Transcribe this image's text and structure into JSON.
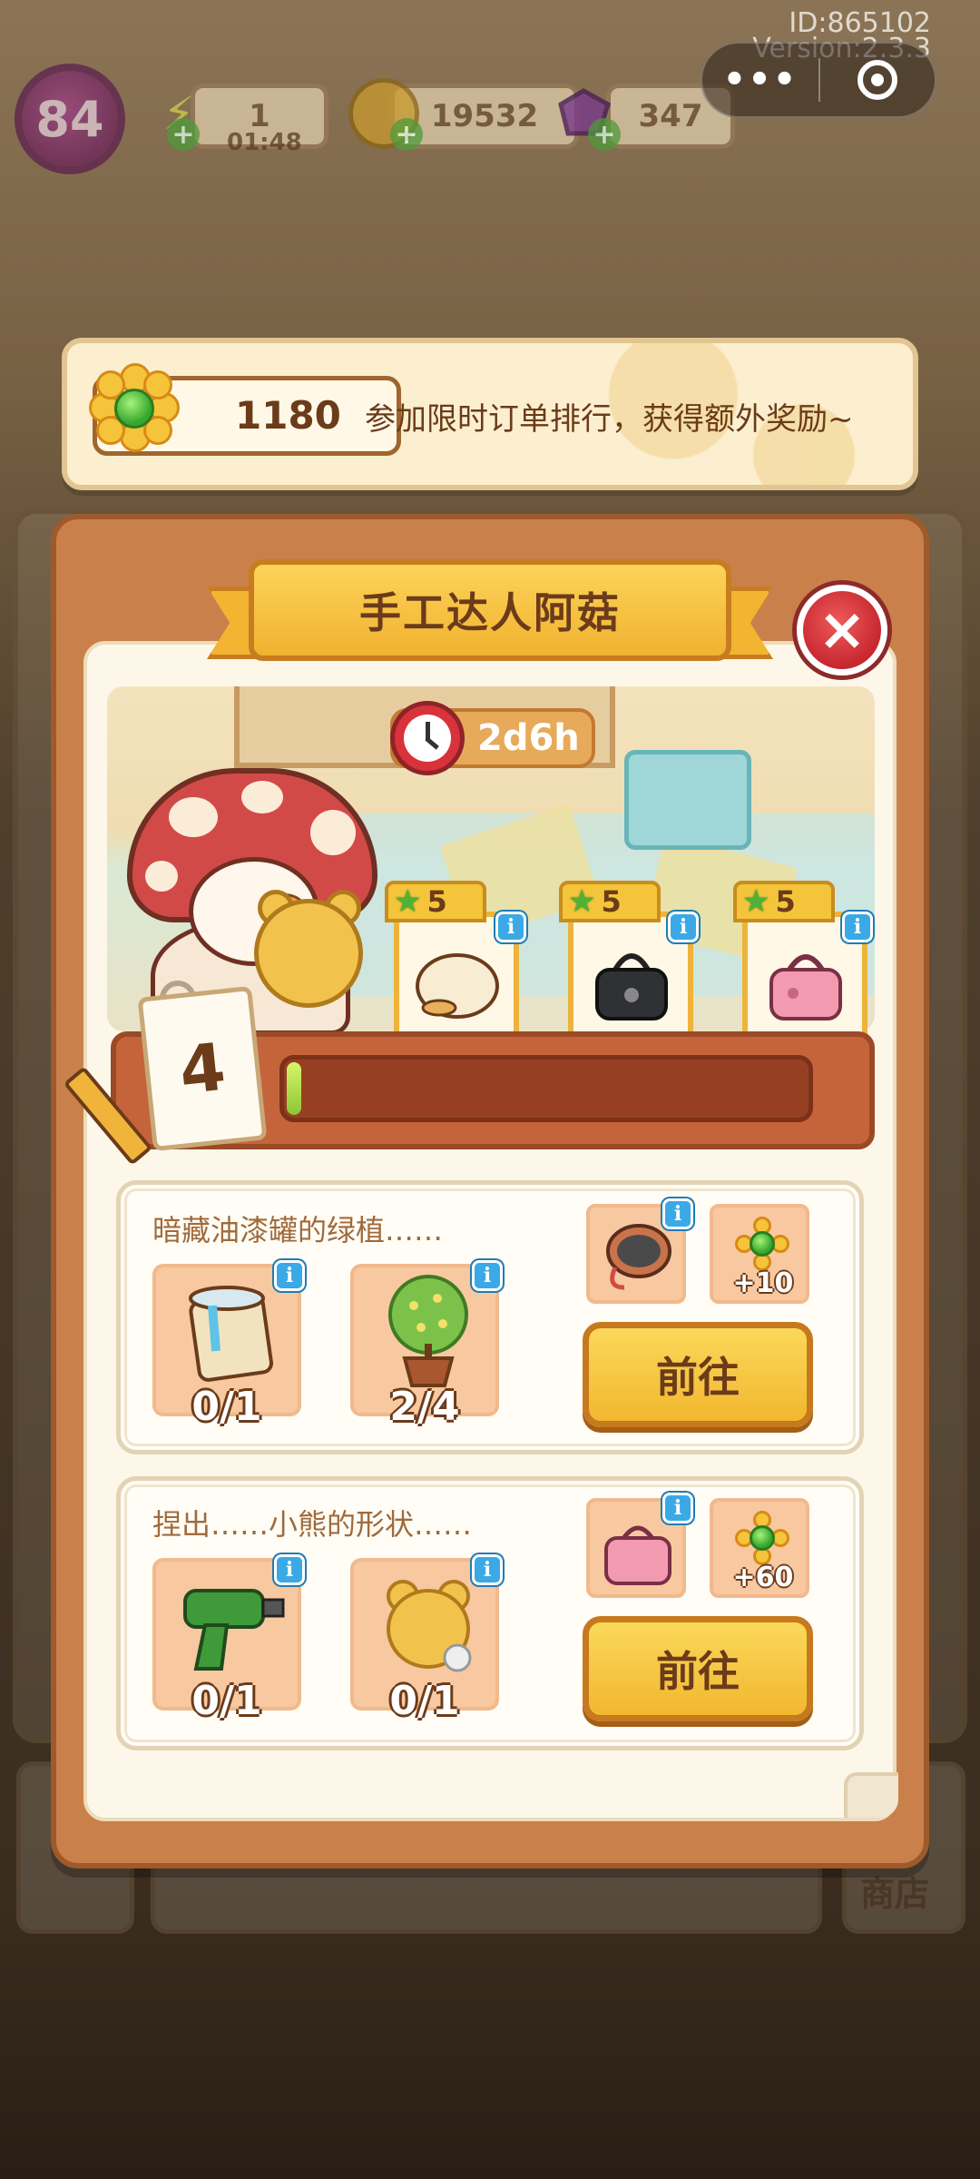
{
  "system": {
    "id_text": "ID:865102",
    "version_text": "Version:2.3.3",
    "capsule_more": "•••"
  },
  "hud": {
    "level": "84",
    "energy": "1",
    "energy_timer": "01:48",
    "coins": "19532",
    "gems": "347"
  },
  "banner": {
    "points": "1180",
    "text": "参加限时订单排行，获得额外奖励~"
  },
  "panel": {
    "title": "手工达人阿菇",
    "close_label": "×",
    "timer": "2d6h",
    "level_number": "4",
    "progress_fraction": 0.02,
    "rewards": [
      {
        "stars": "5",
        "item": "fur-rug",
        "info": "i"
      },
      {
        "stars": "5",
        "item": "black-bag",
        "info": "i"
      },
      {
        "stars": "5",
        "item": "pink-bag",
        "info": "i"
      }
    ]
  },
  "tasks": [
    {
      "description": "暗藏油漆罐的绿植……",
      "requirements": [
        {
          "item": "paint-can",
          "count": "0/1",
          "info": "i"
        },
        {
          "item": "potted-plant",
          "count": "2/4",
          "info": "i"
        }
      ],
      "reward_item": {
        "item": "sewing-basket",
        "info": "i"
      },
      "reward_points": "+10",
      "button_label": "前往"
    },
    {
      "description": "捏出……小熊的形状……",
      "requirements": [
        {
          "item": "power-drill",
          "count": "0/1",
          "info": "i"
        },
        {
          "item": "teddy-bear",
          "count": "0/1",
          "info": "i"
        }
      ],
      "reward_item": {
        "item": "pink-bag",
        "info": "i"
      },
      "reward_points": "+60",
      "button_label": "前往"
    }
  ],
  "background": {
    "shop_label": "商店"
  },
  "colors": {
    "accent_gold": "#f2b72f",
    "panel_brown": "#c9804a",
    "text_brown": "#6b3b1a",
    "close_red": "#d8333a",
    "progress_green": "#8bc734"
  }
}
